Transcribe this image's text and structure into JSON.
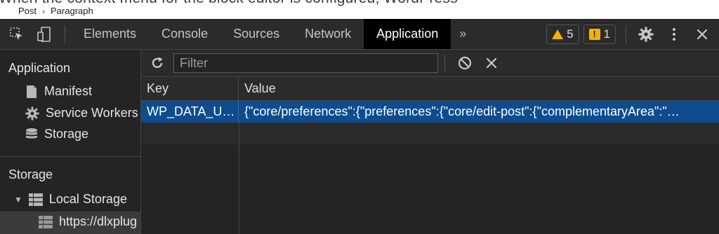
{
  "page": {
    "ghost_text": "When the context menu for the block editor is configured, WordPress",
    "breadcrumb": [
      "Post",
      "Paragraph"
    ]
  },
  "toolbar": {
    "tabs": [
      "Elements",
      "Console",
      "Sources",
      "Network",
      "Application"
    ],
    "active_tab": "Application",
    "more_label": "»",
    "warnings_count": "5",
    "issues_count": "1"
  },
  "sidebar": {
    "application_header": "Application",
    "application_items": [
      "Manifest",
      "Service Workers",
      "Storage"
    ],
    "storage_header": "Storage",
    "local_storage_label": "Local Storage",
    "origin_label": "https://dlxplug"
  },
  "filter": {
    "placeholder": "Filter"
  },
  "table": {
    "columns": [
      "Key",
      "Value"
    ],
    "rows": [
      {
        "key": "WP_DATA_U…",
        "value": "{\"core/preferences\":{\"preferences\":{\"core/edit-post\":{\"complementaryArea\":\"…"
      }
    ]
  },
  "colors": {
    "accent_selection": "#0d4c8e",
    "warning": "#f6b400",
    "background": "#242424"
  }
}
